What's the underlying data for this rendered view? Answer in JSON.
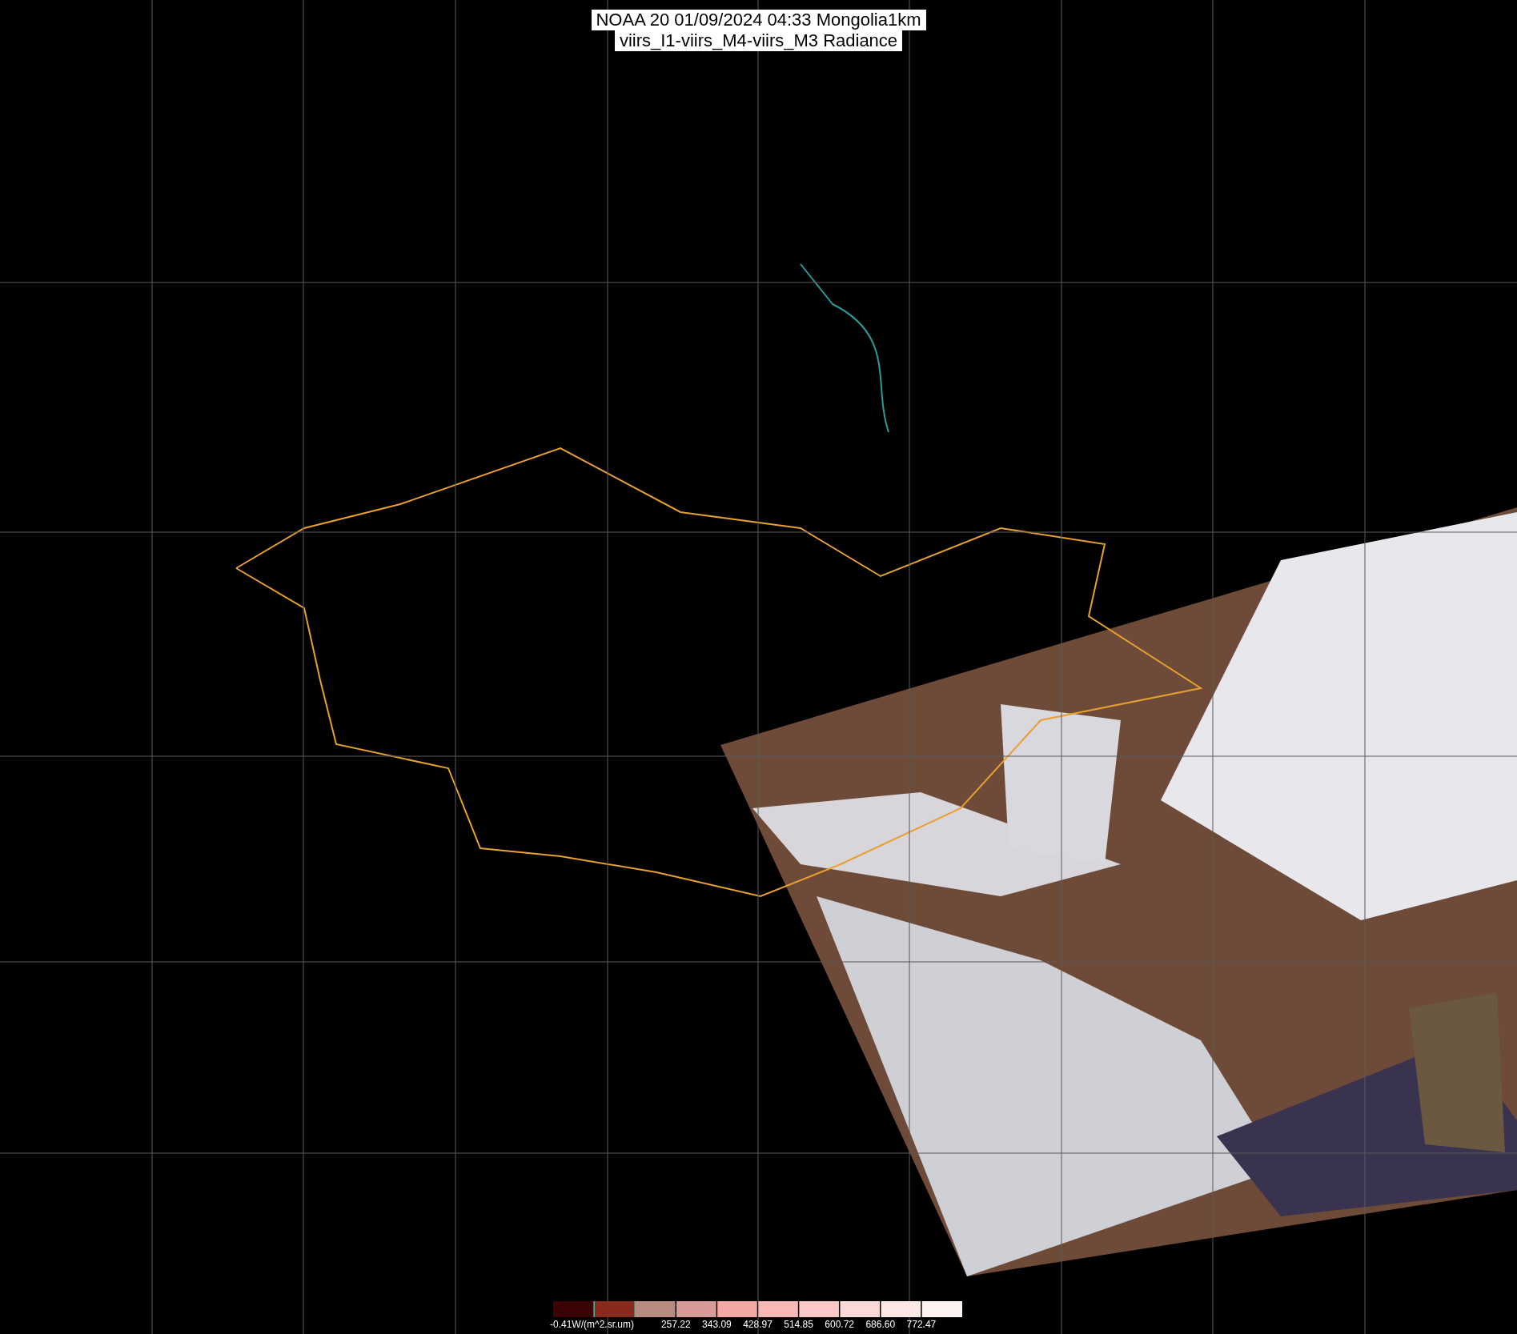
{
  "title": {
    "lines": [
      "NOAA 20 01/09/2024 04:33 Mongolia1km",
      "viirs_I1-viirs_M4-viirs_M3 Radiance"
    ]
  },
  "color_scale": {
    "labels": [
      "-0.41W/(m^2.sr.um)",
      "257.22",
      "343.09",
      "428.97",
      "514.85",
      "600.72",
      "686.60",
      "772.47"
    ]
  }
}
